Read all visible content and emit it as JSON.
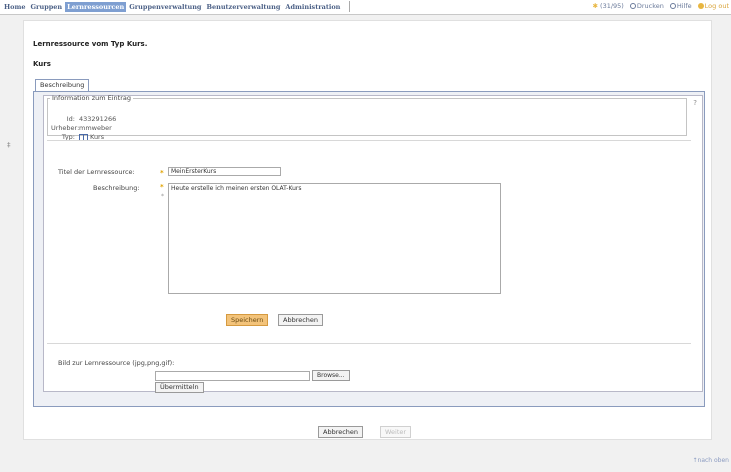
{
  "nav": {
    "items": [
      {
        "label": "Home",
        "active": false
      },
      {
        "label": "Gruppen",
        "active": false
      },
      {
        "label": "Lernressourcen",
        "active": true
      },
      {
        "label": "Gruppenverwaltung",
        "active": false
      },
      {
        "label": "Benutzerverwaltung",
        "active": false
      },
      {
        "label": "Administration",
        "active": false
      }
    ]
  },
  "tools": {
    "count": "(31/95)",
    "print": "Drucken",
    "help": "Hilfe",
    "logout": "Log out"
  },
  "page": {
    "heading": "Lernressource vom Typ Kurs.",
    "subheading": "Kurs"
  },
  "tab": {
    "label": "Beschreibung"
  },
  "info": {
    "legend": "Information zum Eintrag",
    "id_label": "Id:",
    "id_value": "433291266",
    "author_label": "Urheber:",
    "author_value": "mmweber",
    "type_label": "Typ:",
    "type_value": "Kurs"
  },
  "form": {
    "title_label": "Titel der Lernressource:",
    "title_value": "MeinErsterKurs",
    "desc_label": "Beschreibung:",
    "desc_value": "Heute erstelle ich meinen ersten OLAT-Kurs",
    "save_label": "Speichern",
    "cancel_label": "Abbrechen"
  },
  "image": {
    "label": "Bild zur Lernressource (jpg,png,gif):",
    "browse_label": "Browse...",
    "submit_label": "Übermitteln"
  },
  "footer": {
    "cancel_label": "Abbrechen",
    "next_label": "Weiter",
    "top_link": "↑nach oben"
  },
  "colors": {
    "accent": "#7f9fd1",
    "primary_button": "#f3c37a",
    "required": "#e2a300",
    "logout": "#d9a43a"
  },
  "icons": {
    "help": "help-icon",
    "type": "course-icon",
    "print": "print-icon",
    "logout": "logout-icon",
    "count": "star-icon"
  }
}
